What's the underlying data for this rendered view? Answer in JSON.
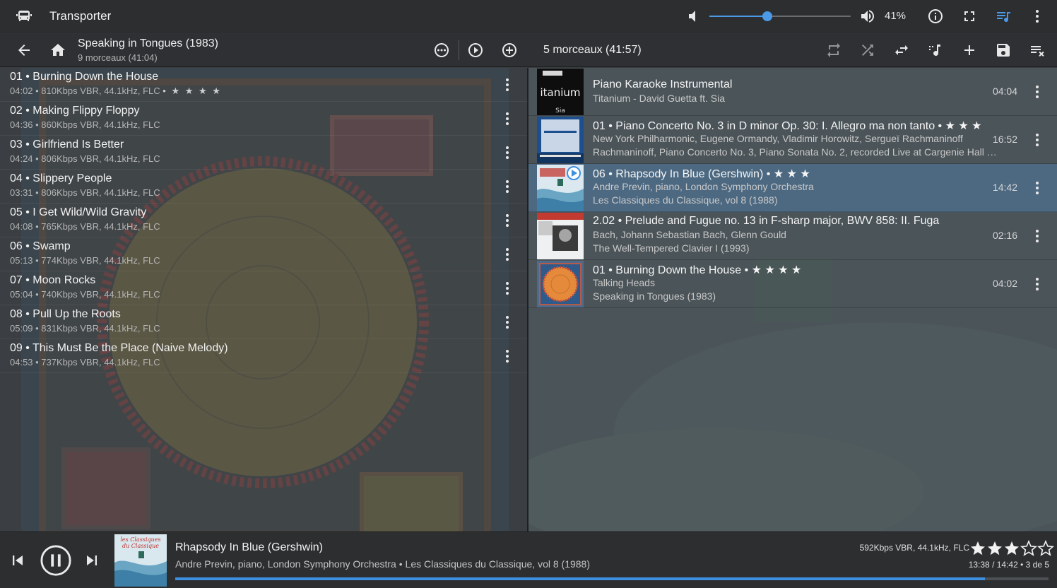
{
  "app": {
    "title": "Transporter"
  },
  "volume": {
    "level": 0.41,
    "label": "41%"
  },
  "album": {
    "title": "Speaking in Tongues (1983)",
    "subtitle": "9 morceaux (41:04)",
    "tracks": [
      {
        "title": "01 • Burning Down the House",
        "details": "04:02 • 810Kbps VBR, 44.1kHz, FLC",
        "rating": "• ★ ★ ★ ★"
      },
      {
        "title": "02 • Making Flippy Floppy",
        "details": "04:36 • 860Kbps VBR, 44.1kHz, FLC",
        "rating": ""
      },
      {
        "title": "03 • Girlfriend Is Better",
        "details": "04:24 • 806Kbps VBR, 44.1kHz, FLC",
        "rating": ""
      },
      {
        "title": "04 • Slippery People",
        "details": "03:31 • 806Kbps VBR, 44.1kHz, FLC",
        "rating": ""
      },
      {
        "title": "05 • I Get Wild/Wild Gravity",
        "details": "04:08 • 765Kbps VBR, 44.1kHz, FLC",
        "rating": ""
      },
      {
        "title": "06 • Swamp",
        "details": "05:13 • 774Kbps VBR, 44.1kHz, FLC",
        "rating": ""
      },
      {
        "title": "07 • Moon Rocks",
        "details": "05:04 • 740Kbps VBR, 44.1kHz, FLC",
        "rating": ""
      },
      {
        "title": "08 • Pull Up the Roots",
        "details": "05:09 • 831Kbps VBR, 44.1kHz, FLC",
        "rating": ""
      },
      {
        "title": "09 • This Must Be the Place (Naive Melody)",
        "details": "04:53 • 737Kbps VBR, 44.1kHz, FLC",
        "rating": ""
      }
    ]
  },
  "queue": {
    "summary": "5 morceaux (41:57)",
    "items": [
      {
        "title": "Piano Karaoke Instrumental",
        "line2": "Titanium - David Guetta ft. Sia",
        "line3": "",
        "duration": "04:04",
        "current": false,
        "cover": "titanium"
      },
      {
        "title": "01 • Piano Concerto No. 3 in D minor Op. 30: I. Allegro ma non tanto • ★ ★ ★",
        "line2": "New York Philharmonic, Eugene Ormandy, Vladimir Horowitz, Sergueï Rachmaninoff",
        "line3": "Rachmaninoff, Piano Concerto No. 3, Piano Sonata No. 2, recorded Live at Cargenie Hall (1…",
        "duration": "16:52",
        "current": false,
        "cover": "horowitz"
      },
      {
        "title": "06 • Rhapsody In Blue (Gershwin) • ★ ★ ★",
        "line2": "Andre Previn, piano, London Symphony Orchestra",
        "line3": "Les Classiques du Classique, vol 8 (1988)",
        "duration": "14:42",
        "current": true,
        "cover": "classiques"
      },
      {
        "title": "2.02 • Prelude and Fugue no. 13 in F-sharp major, BWV 858: II. Fuga",
        "line2": "Bach, Johann Sebastian Bach, Glenn Gould",
        "line3": "The Well-Tempered Clavier I (1993)",
        "duration": "02:16",
        "current": false,
        "cover": "gould"
      },
      {
        "title": "01 • Burning Down the House • ★ ★ ★ ★",
        "line2": "Talking Heads",
        "line3": "Speaking in Tongues (1983)",
        "duration": "04:02",
        "current": false,
        "cover": "tongues"
      }
    ]
  },
  "now_playing": {
    "title": "Rhapsody In Blue (Gershwin)",
    "subtitle": "Andre Previn, piano, London Symphony Orchestra • Les Classiques du Classique, vol 8 (1988)",
    "tech": "592Kbps VBR, 44.1kHz, FLC",
    "rating": 3,
    "rating_max": 5,
    "time": "13:38 / 14:42 • 3 de 5",
    "progress": 0.927,
    "cover_text": {
      "line1": "les Classiques",
      "line2": "du Classique"
    }
  },
  "covers": {
    "titanium": {
      "word": "itanium",
      "artist": "Sia"
    }
  },
  "colors": {
    "accent": "#3d8fe0",
    "current_row": "#4a7aa8"
  }
}
